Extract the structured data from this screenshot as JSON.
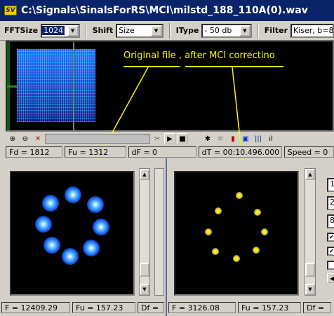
{
  "window": {
    "title": "C:\\Signals\\SinalsForRS\\MCI\\milstd_188_110A(0).wav",
    "app_icon": "SV"
  },
  "toolbar": {
    "fftsize_label": "FFTSize",
    "fftsize_value": "1024",
    "shift_label": "Shift",
    "shift_value": "Size",
    "itype_label": "IType",
    "itype_value": "- 50 db",
    "filter_label": "Filter",
    "filter_value": "Kiser, b=8"
  },
  "annotation": {
    "text": "Original file  , after MCI correctino",
    "color": "#f5f500"
  },
  "status_top": {
    "fd": "Fd = 1812",
    "fu": "Fu = 1312",
    "df": "dF = 0",
    "dt": "dT = 00:10.496.000",
    "speed": "Speed = 0"
  },
  "left_pane": {
    "f": "F = 12409.29",
    "fu": "Fu = 157.23",
    "df": "Df ="
  },
  "right_pane": {
    "f": "F = 3126.08",
    "fu": "Fu = 157.23",
    "df": "Df ="
  },
  "side_fields": [
    "1",
    "2",
    "8"
  ],
  "colors": {
    "title_bg": "#0a246a",
    "annotation": "#f5f500",
    "fuzzy_points": "#1e6bff",
    "sharp_points": "#ffd000"
  }
}
